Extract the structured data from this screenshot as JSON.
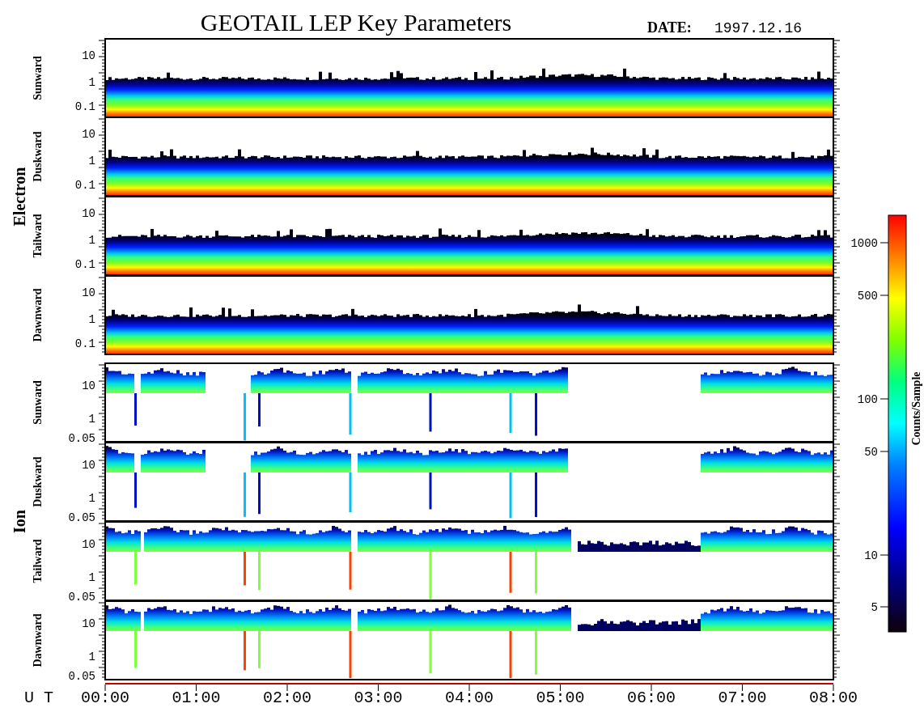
{
  "title": "GEOTAIL LEP Key Parameters",
  "date_label": "DATE:",
  "date": "1997.12.16",
  "groups": [
    {
      "name": "Electron",
      "kind": "electron",
      "panels": [
        {
          "direction": "Sunward",
          "y_ticks": [
            "10",
            "1",
            "0.1"
          ]
        },
        {
          "direction": "Duskward",
          "y_ticks": [
            "10",
            "1",
            "0.1"
          ]
        },
        {
          "direction": "Tailward",
          "y_ticks": [
            "10",
            "1",
            "0.1"
          ]
        },
        {
          "direction": "Dawnward",
          "y_ticks": [
            "10",
            "1",
            "0.1"
          ]
        }
      ]
    },
    {
      "name": "Ion",
      "kind": "ion",
      "panels": [
        {
          "direction": "Sunward",
          "y_ticks": [
            "10",
            "1",
            "0.05"
          ]
        },
        {
          "direction": "Duskward",
          "y_ticks": [
            "10",
            "1",
            "0.05"
          ]
        },
        {
          "direction": "Tailward",
          "y_ticks": [
            "10",
            "1",
            "0.05"
          ]
        },
        {
          "direction": "Dawnward",
          "y_ticks": [
            "10",
            "1",
            "0.05"
          ]
        }
      ]
    }
  ],
  "x_axis": {
    "label": "U T",
    "ticks": [
      "00:00",
      "01:00",
      "02:00",
      "03:00",
      "04:00",
      "05:00",
      "06:00",
      "07:00",
      "08:00"
    ]
  },
  "colorbar": {
    "title": "Counts/Sample",
    "ticks": [
      "1000",
      "500",
      "100",
      "50",
      "10",
      "5"
    ]
  }
}
